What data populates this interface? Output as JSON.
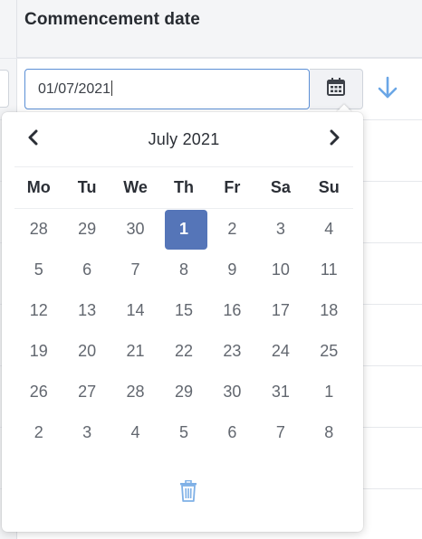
{
  "header": {
    "column_title": "Commencement date"
  },
  "date_field": {
    "value": "01/07/2021"
  },
  "calendar": {
    "month_label": "July 2021",
    "weekdays": [
      "Mo",
      "Tu",
      "We",
      "Th",
      "Fr",
      "Sa",
      "Su"
    ],
    "weeks": [
      [
        "28",
        "29",
        "30",
        "1",
        "2",
        "3",
        "4"
      ],
      [
        "5",
        "6",
        "7",
        "8",
        "9",
        "10",
        "11"
      ],
      [
        "12",
        "13",
        "14",
        "15",
        "16",
        "17",
        "18"
      ],
      [
        "19",
        "20",
        "21",
        "22",
        "23",
        "24",
        "25"
      ],
      [
        "26",
        "27",
        "28",
        "29",
        "30",
        "31",
        "1"
      ],
      [
        "2",
        "3",
        "4",
        "5",
        "6",
        "7",
        "8"
      ]
    ],
    "selected_day": "1"
  },
  "icons": {
    "calendar_button": "calendar-icon",
    "prev": "chevron-left-icon",
    "next": "chevron-right-icon",
    "sort": "arrow-down-icon",
    "clear": "trash-icon"
  },
  "colors": {
    "accent": "#5575b8",
    "input_focus_border": "#5b8fd6",
    "sort_arrow": "#6aa6e6",
    "trash": "#7fb0e6"
  }
}
